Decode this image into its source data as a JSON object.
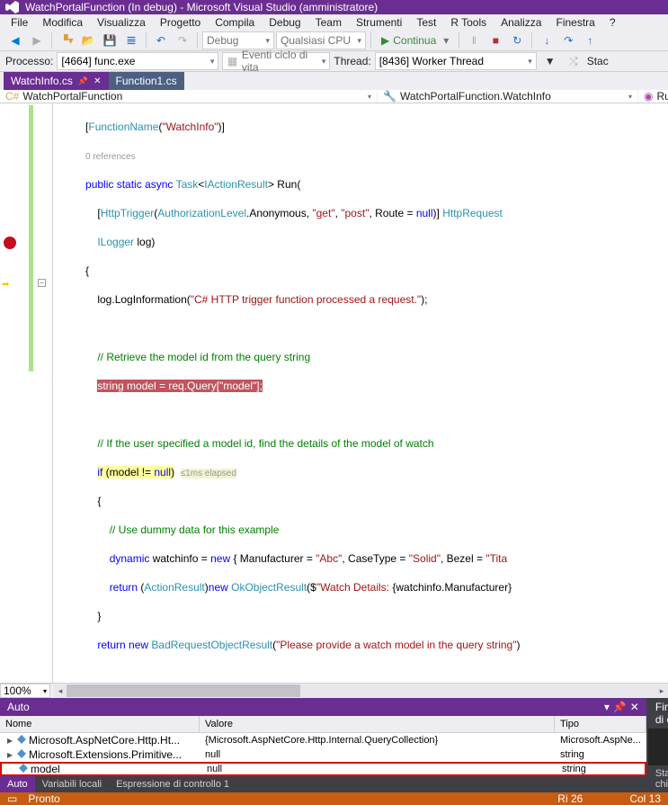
{
  "title": "WatchPortalFunction (In debug) - Microsoft Visual Studio (amministratore)",
  "menu": {
    "file": "File",
    "modifica": "Modifica",
    "visualizza": "Visualizza",
    "progetto": "Progetto",
    "compila": "Compila",
    "debug": "Debug",
    "team": "Team",
    "strumenti": "Strumenti",
    "test": "Test",
    "rtools": "R Tools",
    "analizza": "Analizza",
    "finestra": "Finestra",
    "help": "?"
  },
  "toolbar": {
    "config": "Debug",
    "platform": "Qualsiasi CPU",
    "continua": "Continua"
  },
  "toolbar2": {
    "processo_label": "Processo:",
    "processo": "[4664] func.exe",
    "eventi": "Eventi ciclo di vita",
    "thread_label": "Thread:",
    "thread": "[8436] Worker Thread",
    "stac": "Stac"
  },
  "tabs": {
    "t1": "WatchInfo.cs",
    "t2": "Function1.cs"
  },
  "crumbs": {
    "c1": "WatchPortalFunction",
    "c2": "WatchPortalFunction.WatchInfo",
    "c3": "Run(H"
  },
  "code": {
    "fn_attr_open": "[",
    "fn_attr_name": "FunctionName",
    "fn_attr_p": "(",
    "fn_attr_str": "\"WatchInfo\"",
    "fn_attr_close": ")]",
    "refs": "0 references",
    "public": "public",
    "static": "static",
    "async": "async",
    "task": "Task",
    "iaction": "IActionResult",
    "run": "Run(",
    "http_attr": "[HttpTrigger(",
    "authlevel": "AuthorizationLevel",
    ".anon": ".Anonymous, ",
    "get": "\"get\"",
    ", ": "",
    "post": "\"post\"",
    "route": ", Route = ",
    "null": "null",
    ")] ": "",
    "httpreq": "HttpRequest",
    "ilogger": "ILogger",
    "log": " log)",
    "loginfo": "log.LogInformation(",
    "logstr": "\"C# HTTP trigger function processed a request.\"",
    "logend": ");",
    "cmt1": "// Retrieve the model id from the query string",
    "redline": "string model = req.Query[\"model\"];",
    "cmt2": "// If the user specified a model id, find the details of the model of watch",
    "if": "if",
    "cond": " (model != ",
    "null2": "null",
    ")": "",
    "elapsed": "≤1ms elapsed",
    "brace": "{",
    "cmt3": "// Use dummy data for this example",
    "dynamic": "dynamic",
    "watchinfo": " watchinfo = ",
    "new": "new",
    " obj": " { Manufacturer = ",
    "abc": "\"Abc\"",
    "caset": ", CaseType = ",
    "solid": "\"Solid\"",
    "bezel": ", Bezel = ",
    "tita": "\"Tita",
    "return": "return",
    "cast": " (",
    "actionresult": "ActionResult",
    ")new ": "",
    "okresult": "OkObjectResult",
    "okparen": "($",
    "okstr": "\"Watch Details: ",
    "interp": "{watchinfo.Manufacturer}",
    "brace2": "}",
    "return2": "return",
    "new2": " new ",
    "badreq": "BadRequestObjectResult",
    "badparen": "(",
    "badstr": "\"Please provide a watch model in the query string\"",
    "badend": ")"
  },
  "zoom": "100%",
  "auto": {
    "title": "Auto",
    "col_nome": "Nome",
    "col_valore": "Valore",
    "col_tipo": "Tipo",
    "rows": [
      {
        "name": "Microsoft.AspNetCore.Http.Ht...",
        "value": "{Microsoft.AspNetCore.Http.Internal.QueryCollection}",
        "type": "Microsoft.AspNe..."
      },
      {
        "name": "Microsoft.Extensions.Primitive...",
        "value": "null",
        "type": "string"
      },
      {
        "name": "model",
        "value": "null",
        "type": "string"
      }
    ]
  },
  "bottom_tabs": {
    "auto": "Auto",
    "var": "Variabili locali",
    "espr": "Espressione di controllo 1",
    "fin": "Finestra di c",
    "stack": "Stack di chia"
  },
  "status": {
    "pronto": "Pronto",
    "ri": "Ri 26",
    "col": "Col 13"
  }
}
